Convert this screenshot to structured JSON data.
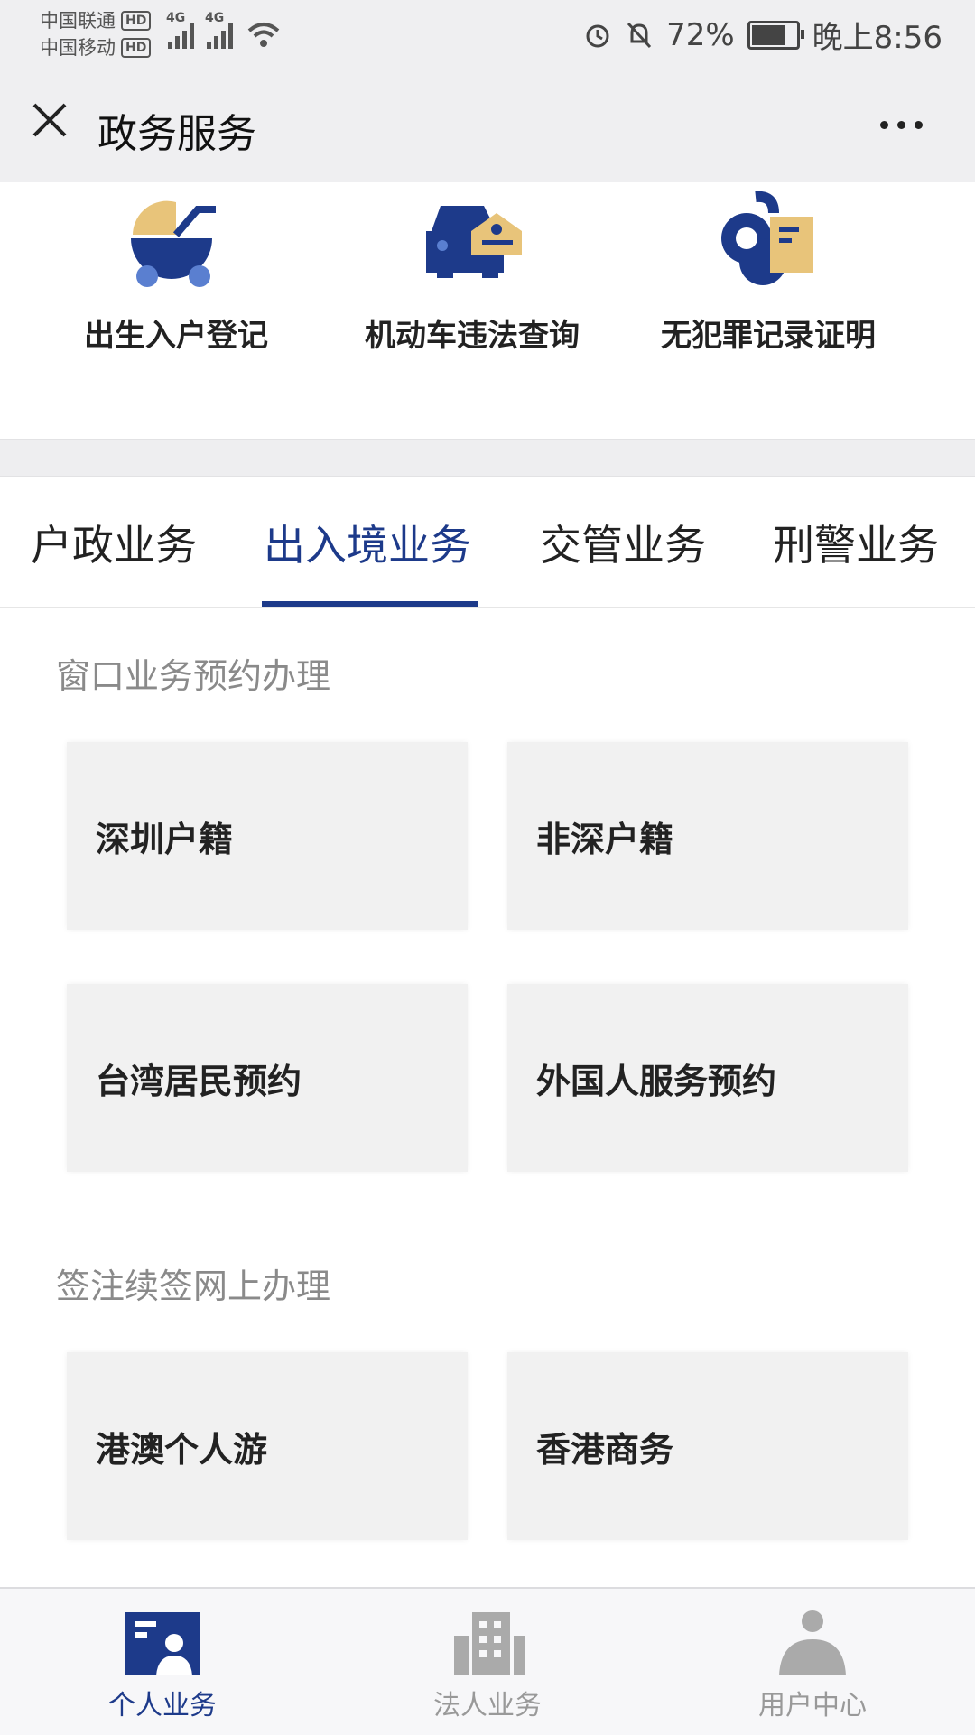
{
  "status_bar": {
    "carrier1": "中国联通",
    "carrier2": "中国移动",
    "hd_label": "HD",
    "network1": "4G",
    "network2": "4G",
    "battery": "72%",
    "time": "晚上8:56"
  },
  "header": {
    "title": "政务服务"
  },
  "quick_services": [
    {
      "label": "出生入户登记",
      "icon": "baby-stroller-icon"
    },
    {
      "label": "机动车违法查询",
      "icon": "car-police-icon"
    },
    {
      "label": "无犯罪记录证明",
      "icon": "handcuffs-document-icon"
    }
  ],
  "tabs": [
    {
      "label": "户政业务",
      "active": false
    },
    {
      "label": "出入境业务",
      "active": true
    },
    {
      "label": "交管业务",
      "active": false
    },
    {
      "label": "刑警业务",
      "active": false
    }
  ],
  "sections": [
    {
      "title": "窗口业务预约办理",
      "items": [
        "深圳户籍",
        "非深户籍",
        "台湾居民预约",
        "外国人服务预约"
      ]
    },
    {
      "title": "签注续签网上办理",
      "items": [
        "港澳个人游",
        "香港商务"
      ]
    }
  ],
  "bottom_nav": [
    {
      "label": "个人业务",
      "icon": "person-card-icon",
      "active": true
    },
    {
      "label": "法人业务",
      "icon": "building-icon",
      "active": false
    },
    {
      "label": "用户中心",
      "icon": "user-icon",
      "active": false
    }
  ],
  "colors": {
    "accent": "#1d3a8a",
    "icon_yellow": "#e8c47a",
    "card_bg": "#f1f1f1"
  }
}
